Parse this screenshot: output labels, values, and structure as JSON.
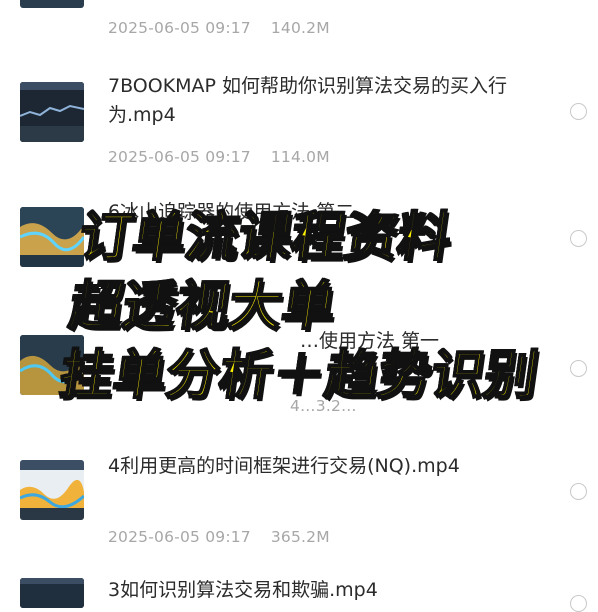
{
  "files": [
    {
      "name": "",
      "date": "2025-06-05 09:17",
      "size": "140.2M"
    },
    {
      "name": "7BOOKMAP 如何帮助你识别算法交易的买入行为.mp4",
      "date": "2025-06-05 09:17",
      "size": "114.0M"
    },
    {
      "name": "6冰山追踪器的使用方法 第二",
      "date": "",
      "size": ""
    },
    {
      "name": "…使用方法 第一",
      "date": "",
      "size": "4…3.2…"
    },
    {
      "name": "4利用更高的时间框架进行交易(NQ).mp4",
      "date": "2025-06-05 09:17",
      "size": "365.2M"
    },
    {
      "name": "3如何识别算法交易和欺骗.mp4",
      "date": "",
      "size": ""
    }
  ],
  "overlay": {
    "lines": [
      "订单流课程资料",
      "超透视大单",
      "挂单分析＋趋势识别"
    ],
    "color": "#fff200"
  },
  "icons": {
    "select": "radio-circle-icon",
    "thumb": "video-thumbnail-icon"
  }
}
